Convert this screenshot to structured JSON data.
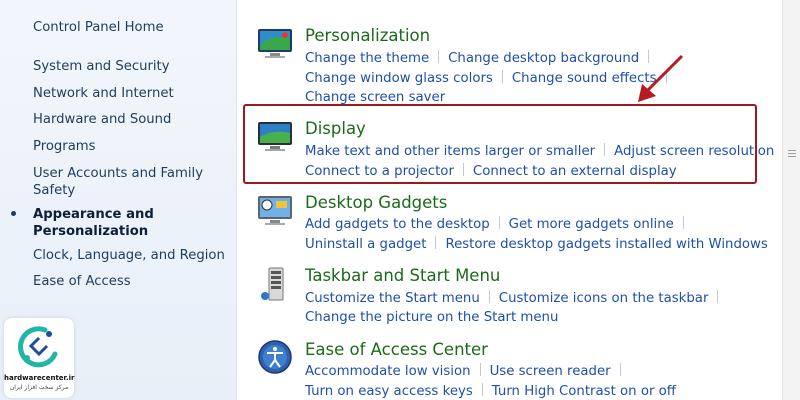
{
  "sidebar": {
    "home": "Control Panel Home",
    "items": [
      {
        "label": "System and Security"
      },
      {
        "label": "Network and Internet"
      },
      {
        "label": "Hardware and Sound"
      },
      {
        "label": "Programs"
      },
      {
        "label_line1": "User Accounts and Family",
        "label_line2": "Safety"
      },
      {
        "label_line1": "Appearance and",
        "label_line2": "Personalization"
      },
      {
        "label": "Clock, Language, and Region"
      },
      {
        "label": "Ease of Access"
      }
    ]
  },
  "categories": [
    {
      "title": "Personalization",
      "icon": "personalization-icon",
      "rows": [
        [
          "Change the theme",
          "Change desktop background"
        ],
        [
          "Change window glass colors",
          "Change sound effects"
        ],
        [
          "Change screen saver"
        ]
      ]
    },
    {
      "title": "Display",
      "icon": "display-icon",
      "rows": [
        [
          "Make text and other items larger or smaller",
          "Adjust screen resolution"
        ],
        [
          "Connect to a projector",
          "Connect to an external display"
        ]
      ]
    },
    {
      "title": "Desktop Gadgets",
      "icon": "gadgets-icon",
      "rows": [
        [
          "Add gadgets to the desktop",
          "Get more gadgets online"
        ],
        [
          "Uninstall a gadget",
          "Restore desktop gadgets installed with Windows"
        ]
      ]
    },
    {
      "title": "Taskbar and Start Menu",
      "icon": "taskbar-icon",
      "rows": [
        [
          "Customize the Start menu",
          "Customize icons on the taskbar"
        ],
        [
          "Change the picture on the Start menu"
        ]
      ]
    },
    {
      "title": "Ease of Access Center",
      "icon": "ease-of-access-icon",
      "rows": [
        [
          "Accommodate low vision",
          "Use screen reader"
        ],
        [
          "Turn on easy access keys",
          "Turn High Contrast on or off"
        ]
      ]
    }
  ],
  "watermark": {
    "brand": "hardwarecenter.ir",
    "subtitle": "مرکز سخت افزار ایران"
  },
  "colors": {
    "link": "#1f4fa8",
    "title": "#1b6a1b",
    "highlight": "#9c1a1f",
    "arrow": "#b51c22"
  }
}
